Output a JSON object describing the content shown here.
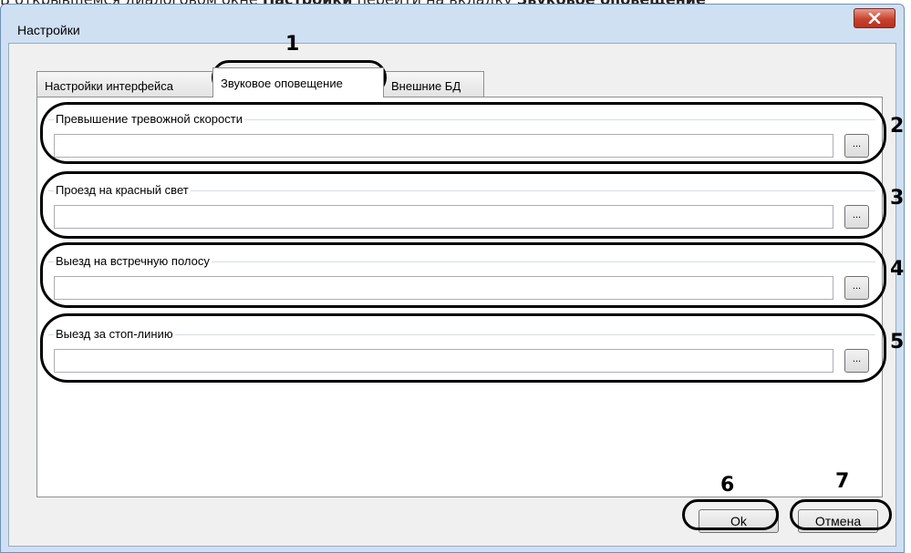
{
  "caption": {
    "prefix": "В открывшемся диалоговом окне ",
    "bold1": "Настройки",
    "middle": " перейти на вкладку ",
    "bold2": "Звуковое оповещение"
  },
  "window": {
    "title": "Настройки",
    "close_icon": "close-x-icon"
  },
  "tabs": [
    {
      "label": "Настройки интерфейса",
      "active": false
    },
    {
      "label": "Звуковое оповещение",
      "active": true
    },
    {
      "label": "Внешние БД",
      "active": false
    }
  ],
  "groups": [
    {
      "label": "Превышение тревожной скорости",
      "value": "",
      "browse_label": "..."
    },
    {
      "label": "Проезд на красный свет",
      "value": "",
      "browse_label": "..."
    },
    {
      "label": "Выезд на встречную полосу",
      "value": "",
      "browse_label": "..."
    },
    {
      "label": "Выезд за стоп-линию",
      "value": "",
      "browse_label": "..."
    }
  ],
  "buttons": {
    "ok": "Ok",
    "cancel": "Отмена"
  },
  "annotations": [
    "1",
    "2",
    "3",
    "4",
    "5",
    "6",
    "7"
  ]
}
